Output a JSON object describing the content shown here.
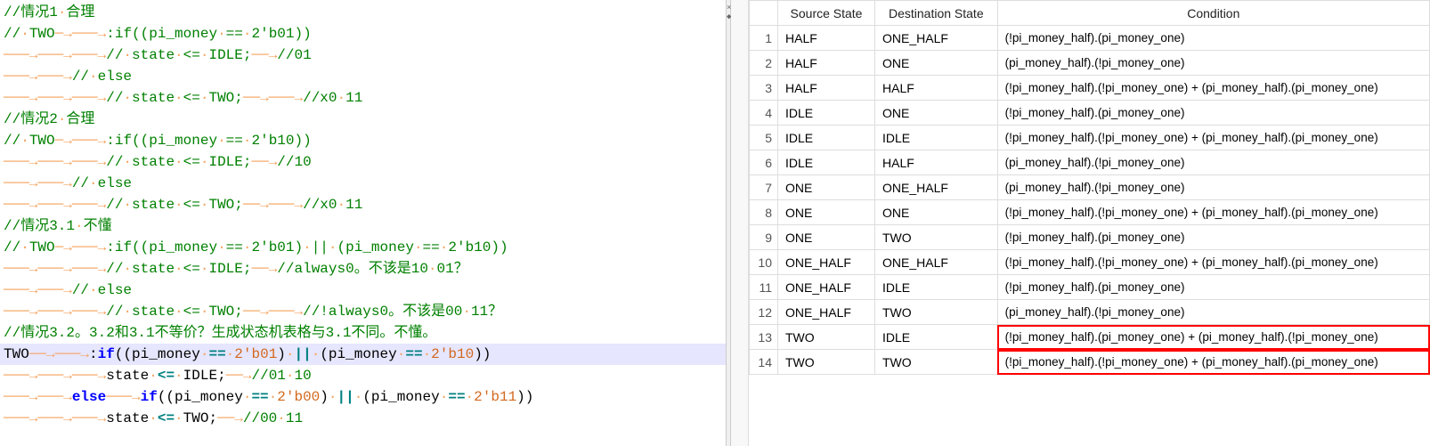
{
  "editor": {
    "lines": [
      {
        "html": "<span class='cm'>//情况1<span class='dot'>·</span>合理</span>"
      },
      {
        "html": "<span class='cm'>//<span class='dot'>·</span>TWO<span class='arrow'>─→───→</span>:if((pi_money<span class='dot'>·</span>==<span class='dot'>·</span>2'b01))</span>"
      },
      {
        "html": "<span class='arrow'>───→───→───→</span><span class='cm'>//<span class='dot'>·</span>state<span class='dot'>·</span>&lt;=<span class='dot'>·</span>IDLE;<span class='arrow'>──→</span>//01</span>"
      },
      {
        "html": "<span class='arrow'>───→───→</span><span class='cm'>//<span class='dot'>·</span>else</span>"
      },
      {
        "html": "<span class='arrow'>───→───→───→</span><span class='cm'>//<span class='dot'>·</span>state<span class='dot'>·</span>&lt;=<span class='dot'>·</span>TWO;<span class='arrow'>──→───→</span>//x0<span class='dot'>·</span>11</span>"
      },
      {
        "html": "<span class='cm'>//情况2<span class='dot'>·</span>合理</span>"
      },
      {
        "html": "<span class='cm'>//<span class='dot'>·</span>TWO<span class='arrow'>─→───→</span>:if((pi_money<span class='dot'>·</span>==<span class='dot'>·</span>2'b10))</span>"
      },
      {
        "html": "<span class='arrow'>───→───→───→</span><span class='cm'>//<span class='dot'>·</span>state<span class='dot'>·</span>&lt;=<span class='dot'>·</span>IDLE;<span class='arrow'>──→</span>//10</span>"
      },
      {
        "html": "<span class='arrow'>───→───→</span><span class='cm'>//<span class='dot'>·</span>else</span>"
      },
      {
        "html": "<span class='arrow'>───→───→───→</span><span class='cm'>//<span class='dot'>·</span>state<span class='dot'>·</span>&lt;=<span class='dot'>·</span>TWO;<span class='arrow'>──→───→</span>//x0<span class='dot'>·</span>11</span>"
      },
      {
        "html": "<span class='cm'>//情况3.1<span class='dot'>·</span>不懂</span>"
      },
      {
        "html": "<span class='cm'>//<span class='dot'>·</span>TWO<span class='arrow'>─→───→</span>:if((pi_money<span class='dot'>·</span>==<span class='dot'>·</span>2'b01)<span class='dot'>·</span>||<span class='dot'>·</span>(pi_money<span class='dot'>·</span>==<span class='dot'>·</span>2'b10))</span>"
      },
      {
        "html": "<span class='arrow'>───→───→───→</span><span class='cm'>//<span class='dot'>·</span>state<span class='dot'>·</span>&lt;=<span class='dot'>·</span>IDLE;<span class='arrow'>──→</span>//always0。不该是10<span class='dot'>·</span>01？</span>"
      },
      {
        "html": "<span class='arrow'>───→───→</span><span class='cm'>//<span class='dot'>·</span>else</span>"
      },
      {
        "html": "<span class='arrow'>───→───→───→</span><span class='cm'>//<span class='dot'>·</span>state<span class='dot'>·</span>&lt;=<span class='dot'>·</span>TWO;<span class='arrow'>──→───→</span>//!always0。不该是00<span class='dot'>·</span>11？</span>"
      },
      {
        "html": "<span class='cm'>//情况3.2。3.2和3.1不等价？生成状态机表格与3.1不同。不懂。</span>"
      },
      {
        "html": "<span class='id'>TWO</span><span class='arrow'>──→───→</span><span class='id'>:</span><span class='kw'>if</span><span class='id'>((pi_money<span class='dot'>·</span></span><span class='op'>==</span><span class='dot'>·</span><span class='num'>2'b01</span><span class='id'>)<span class='dot'>·</span></span><span class='op'>||</span><span class='id'><span class='dot'>·</span>(pi_money<span class='dot'>·</span></span><span class='op'>==</span><span class='dot'>·</span><span class='num'>2'b10</span><span class='id'>))</span>",
        "current": true
      },
      {
        "html": "<span class='arrow'>───→───→───→</span><span class='id'>state<span class='dot'>·</span></span><span class='op'>&lt;=</span><span class='id'><span class='dot'>·</span>IDLE;<span class='arrow'>──→</span></span><span class='cm'>//01<span class='dot'>·</span>10</span>"
      },
      {
        "html": "<span class='arrow'>───→───→</span><span class='kw'>else</span><span class='arrow'>───→</span><span class='kw'>if</span><span class='id'>((pi_money<span class='dot'>·</span></span><span class='op'>==</span><span class='dot'>·</span><span class='num'>2'b00</span><span class='id'>)<span class='dot'>·</span></span><span class='op'>||</span><span class='id'><span class='dot'>·</span>(pi_money<span class='dot'>·</span></span><span class='op'>==</span><span class='dot'>·</span><span class='num'>2'b11</span><span class='id'>))</span>"
      },
      {
        "html": "<span class='arrow'>───→───→───→</span><span class='id'>state<span class='dot'>·</span></span><span class='op'>&lt;=</span><span class='id'><span class='dot'>·</span>TWO;<span class='arrow'>──→</span></span><span class='cm'>//00<span class='dot'>·</span>11</span>"
      }
    ]
  },
  "table": {
    "headers": {
      "src": "Source State",
      "dst": "Destination State",
      "cond": "Condition"
    },
    "rows": [
      {
        "n": "1",
        "src": "HALF",
        "dst": "ONE_HALF",
        "cond": "(!pi_money_half).(pi_money_one)",
        "hl": false
      },
      {
        "n": "2",
        "src": "HALF",
        "dst": "ONE",
        "cond": "(pi_money_half).(!pi_money_one)",
        "hl": false
      },
      {
        "n": "3",
        "src": "HALF",
        "dst": "HALF",
        "cond": "(!pi_money_half).(!pi_money_one) + (pi_money_half).(pi_money_one)",
        "hl": false
      },
      {
        "n": "4",
        "src": "IDLE",
        "dst": "ONE",
        "cond": "(!pi_money_half).(pi_money_one)",
        "hl": false
      },
      {
        "n": "5",
        "src": "IDLE",
        "dst": "IDLE",
        "cond": "(!pi_money_half).(!pi_money_one) + (pi_money_half).(pi_money_one)",
        "hl": false
      },
      {
        "n": "6",
        "src": "IDLE",
        "dst": "HALF",
        "cond": "(pi_money_half).(!pi_money_one)",
        "hl": false
      },
      {
        "n": "7",
        "src": "ONE",
        "dst": "ONE_HALF",
        "cond": "(pi_money_half).(!pi_money_one)",
        "hl": false
      },
      {
        "n": "8",
        "src": "ONE",
        "dst": "ONE",
        "cond": "(!pi_money_half).(!pi_money_one) + (pi_money_half).(pi_money_one)",
        "hl": false
      },
      {
        "n": "9",
        "src": "ONE",
        "dst": "TWO",
        "cond": "(!pi_money_half).(pi_money_one)",
        "hl": false
      },
      {
        "n": "10",
        "src": "ONE_HALF",
        "dst": "ONE_HALF",
        "cond": "(!pi_money_half).(!pi_money_one) + (pi_money_half).(pi_money_one)",
        "hl": false
      },
      {
        "n": "11",
        "src": "ONE_HALF",
        "dst": "IDLE",
        "cond": "(!pi_money_half).(pi_money_one)",
        "hl": false
      },
      {
        "n": "12",
        "src": "ONE_HALF",
        "dst": "TWO",
        "cond": "(pi_money_half).(!pi_money_one)",
        "hl": false
      },
      {
        "n": "13",
        "src": "TWO",
        "dst": "IDLE",
        "cond": "(!pi_money_half).(pi_money_one) + (pi_money_half).(!pi_money_one)",
        "hl": true
      },
      {
        "n": "14",
        "src": "TWO",
        "dst": "TWO",
        "cond": "(!pi_money_half).(!pi_money_one) + (pi_money_half).(pi_money_one)",
        "hl": true
      }
    ]
  },
  "divider": {
    "close": "×",
    "pin": "◆"
  }
}
